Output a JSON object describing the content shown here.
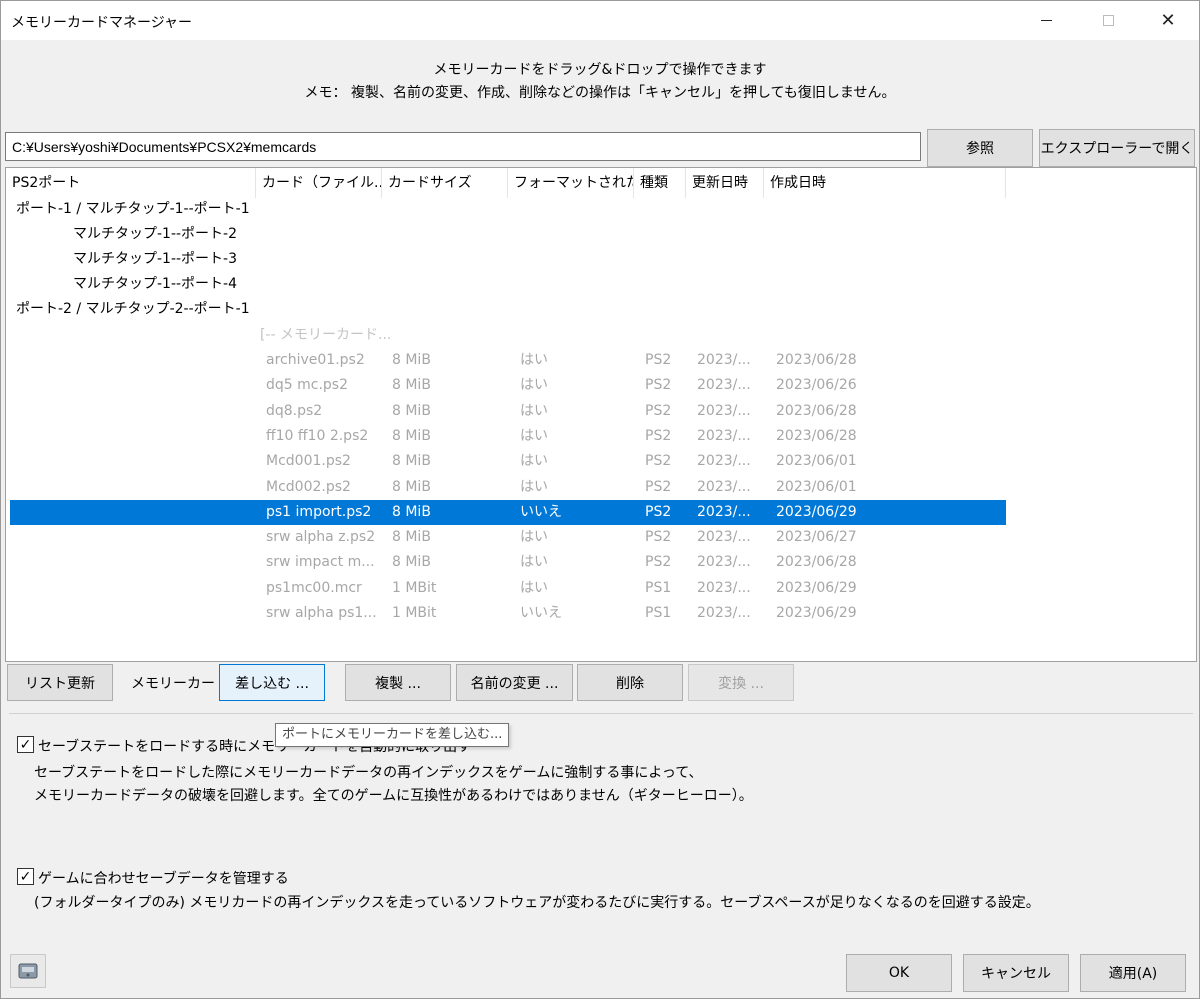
{
  "window": {
    "title": "メモリーカードマネージャー",
    "min_glyph": "",
    "close_glyph": "✕"
  },
  "notice": {
    "line1": "メモリーカードをドラッグ&ドロップで操作できます",
    "line2": "メモ： 複製、名前の変更、作成、削除などの操作は「キャンセル」を押しても復旧しません。"
  },
  "path": {
    "value": "C:¥Users¥yoshi¥Documents¥PCSX2¥memcards",
    "browse_label": "参照",
    "open_explorer_label": "エクスプローラーで開く"
  },
  "list": {
    "columns": [
      "PS2ポート",
      "カード（ファイル...",
      "カードサイズ",
      "フォーマットされた",
      "種類",
      "更新日時",
      "作成日時"
    ],
    "ports": [
      {
        "label": "ポート-1 / マルチタップ-1--ポート-1"
      },
      {
        "label": "マルチタップ-1--ポート-2"
      },
      {
        "label": "マルチタップ-1--ポート-3"
      },
      {
        "label": "マルチタップ-1--ポート-4"
      },
      {
        "label": "ポート-2 / マルチタップ-2--ポート-1"
      }
    ],
    "group_header": "[-- メモリーカード...",
    "cards": [
      {
        "name": "archive01.ps2",
        "size": "8 MiB",
        "formatted": "はい",
        "type": "PS2",
        "modified": "2023/...",
        "created": "2023/06/28"
      },
      {
        "name": "dq5 mc.ps2",
        "size": "8 MiB",
        "formatted": "はい",
        "type": "PS2",
        "modified": "2023/...",
        "created": "2023/06/26"
      },
      {
        "name": "dq8.ps2",
        "size": "8 MiB",
        "formatted": "はい",
        "type": "PS2",
        "modified": "2023/...",
        "created": "2023/06/28"
      },
      {
        "name": "ff10 ff10 2.ps2",
        "size": "8 MiB",
        "formatted": "はい",
        "type": "PS2",
        "modified": "2023/...",
        "created": "2023/06/28"
      },
      {
        "name": "Mcd001.ps2",
        "size": "8 MiB",
        "formatted": "はい",
        "type": "PS2",
        "modified": "2023/...",
        "created": "2023/06/01"
      },
      {
        "name": "Mcd002.ps2",
        "size": "8 MiB",
        "formatted": "はい",
        "type": "PS2",
        "modified": "2023/...",
        "created": "2023/06/01"
      },
      {
        "name": "ps1 import.ps2",
        "size": "8 MiB",
        "formatted": "いいえ",
        "type": "PS2",
        "modified": "2023/...",
        "created": "2023/06/29",
        "selected": true
      },
      {
        "name": "srw alpha z.ps2",
        "size": "8 MiB",
        "formatted": "はい",
        "type": "PS2",
        "modified": "2023/...",
        "created": "2023/06/27"
      },
      {
        "name": "srw impact m...",
        "size": "8 MiB",
        "formatted": "はい",
        "type": "PS2",
        "modified": "2023/...",
        "created": "2023/06/28"
      },
      {
        "name": "ps1mc00.mcr",
        "size": "1 MBit",
        "formatted": "はい",
        "type": "PS1",
        "modified": "2023/...",
        "created": "2023/06/29"
      },
      {
        "name": "srw alpha ps1...",
        "size": "1 MBit",
        "formatted": "いいえ",
        "type": "PS1",
        "modified": "2023/...",
        "created": "2023/06/29"
      }
    ]
  },
  "actions": {
    "refresh_label": "リスト更新",
    "memcard_label": "メモリーカード:",
    "insert_label": "差し込む ...",
    "duplicate_label": "複製 ...",
    "rename_label": "名前の変更 ...",
    "delete_label": "削除",
    "convert_label": "変換 ..."
  },
  "tooltip": "ポートにメモリーカードを差し込む...",
  "option1": {
    "checked": true,
    "check_glyph": "✓",
    "label": "セーブステートをロードする時にメモリーカードを自動的に取り出す",
    "desc1": "セーブステートをロードした際にメモリーカードデータの再インデックスをゲームに強制する事によって、",
    "desc2": "メモリーカードデータの破壊を回避します。全てのゲームに互換性があるわけではありません（ギターヒーロー）。"
  },
  "option2": {
    "checked": true,
    "check_glyph": "✓",
    "label": "ゲームに合わせセーブデータを管理する",
    "desc1": "(フォルダータイプのみ) メモリカードの再インデックスを走っているソフトウェアが変わるたびに実行する。セーブスペースが足りなくなるのを回避する設定。"
  },
  "footer": {
    "ok_label": "OK",
    "cancel_label": "キャンセル",
    "apply_label": "適用(A)"
  }
}
